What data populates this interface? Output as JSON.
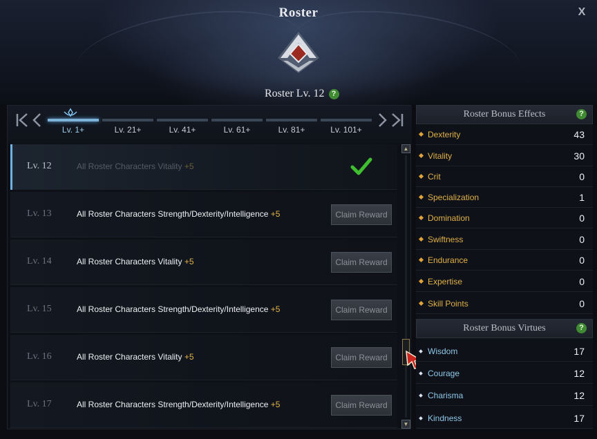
{
  "window": {
    "title": "Roster",
    "close_label": "X"
  },
  "roster": {
    "level_label": "Roster Lv. 12",
    "help": "?"
  },
  "tabs": [
    {
      "label": "Lv. 1+",
      "active": true
    },
    {
      "label": "Lv. 21+",
      "active": false
    },
    {
      "label": "Lv. 41+",
      "active": false
    },
    {
      "label": "Lv. 61+",
      "active": false
    },
    {
      "label": "Lv. 81+",
      "active": false
    },
    {
      "label": "Lv. 101+",
      "active": false
    }
  ],
  "nav": {
    "first": "K",
    "prev": "<",
    "next": ">",
    "last": "K"
  },
  "rows": [
    {
      "level": "Lv. 12",
      "text": "All Roster Characters Vitality",
      "bonus": "+5",
      "status": "claimed"
    },
    {
      "level": "Lv. 13",
      "text": "All Roster Characters Strength/Dexterity/Intelligence",
      "bonus": "+5",
      "status": "locked",
      "button": "Claim Reward"
    },
    {
      "level": "Lv. 14",
      "text": "All Roster Characters Vitality",
      "bonus": "+5",
      "status": "locked",
      "button": "Claim Reward"
    },
    {
      "level": "Lv. 15",
      "text": "All Roster Characters Strength/Dexterity/Intelligence",
      "bonus": "+5",
      "status": "locked",
      "button": "Claim Reward"
    },
    {
      "level": "Lv. 16",
      "text": "All Roster Characters Vitality",
      "bonus": "+5",
      "status": "locked",
      "button": "Claim Reward"
    },
    {
      "level": "Lv. 17",
      "text": "All Roster Characters Strength/Dexterity/Intelligence",
      "bonus": "+5",
      "status": "locked",
      "button": "Claim Reward"
    }
  ],
  "bonus_effects": {
    "title": "Roster Bonus Effects",
    "help": "?",
    "items": [
      {
        "name": "Dexterity",
        "value": "43"
      },
      {
        "name": "Vitality",
        "value": "30"
      },
      {
        "name": "Crit",
        "value": "0"
      },
      {
        "name": "Specialization",
        "value": "1"
      },
      {
        "name": "Domination",
        "value": "0"
      },
      {
        "name": "Swiftness",
        "value": "0"
      },
      {
        "name": "Endurance",
        "value": "0"
      },
      {
        "name": "Expertise",
        "value": "0"
      },
      {
        "name": "Skill Points",
        "value": "0"
      }
    ]
  },
  "bonus_virtues": {
    "title": "Roster Bonus Virtues",
    "help": "?",
    "items": [
      {
        "name": "Wisdom",
        "value": "17"
      },
      {
        "name": "Courage",
        "value": "12"
      },
      {
        "name": "Charisma",
        "value": "12"
      },
      {
        "name": "Kindness",
        "value": "17"
      }
    ]
  },
  "colors": {
    "accent": "#7fb2d8",
    "bonus": "#e2b34a",
    "virtue": "#8fc8ea",
    "check": "#3fbf2f"
  }
}
